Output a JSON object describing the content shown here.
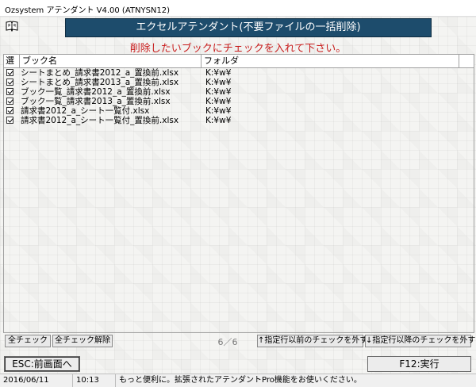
{
  "window": {
    "title": "Ozsystem アテンダント V4.00 (ATNYSN12)"
  },
  "header": {
    "banner": "エクセルアテンダント(不要ファイルの一括削除)",
    "instruction": "削除したいブックにチェックを入れて下さい。"
  },
  "grid": {
    "columns": {
      "select": "選",
      "book": "ブック名",
      "folder": "フォルダ"
    },
    "rows": [
      {
        "checked": true,
        "book": "シートまとめ_請求書2012_a_置換前.xlsx",
        "folder": "K:¥w¥"
      },
      {
        "checked": true,
        "book": "シートまとめ_請求書2013_a_置換前.xlsx",
        "folder": "K:¥w¥"
      },
      {
        "checked": true,
        "book": "ブック一覧_請求書2012_a_置換前.xlsx",
        "folder": "K:¥w¥"
      },
      {
        "checked": true,
        "book": "ブック一覧_請求書2013_a_置換前.xlsx",
        "folder": "K:¥w¥"
      },
      {
        "checked": true,
        "book": "請求書2012_a_シート一覧付.xlsx",
        "folder": "K:¥w¥"
      },
      {
        "checked": true,
        "book": "請求書2012_a_シート一覧付_置換前.xlsx",
        "folder": "K:¥w¥"
      }
    ]
  },
  "buttons": {
    "check_all": "全チェック",
    "uncheck_all": "全チェック解除",
    "counter": "6／6",
    "uncheck_before": "↑指定行以前のチェックを外す",
    "uncheck_after": "↓指定行以降のチェックを外す",
    "esc": "ESC:前画面へ",
    "run": "F12:実行"
  },
  "status": {
    "date": "2016/06/11",
    "time": "10:13",
    "message": "もっと便利に。拡張されたアテンダントPro機能をお使いください。"
  },
  "colors": {
    "banner": "#1d4c6c",
    "instruction": "#c81e1e"
  }
}
